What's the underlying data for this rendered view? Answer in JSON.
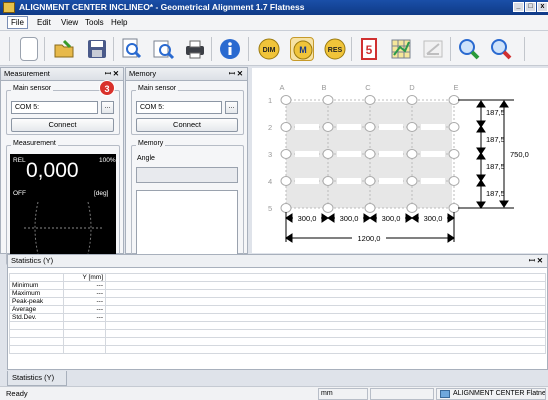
{
  "window": {
    "title": "ALIGNMENT CENTER INCLINEO* - Geometrical Alignment 1.7 Flatness",
    "min_label": "_",
    "max_label": "□",
    "close_label": "x"
  },
  "menu": {
    "file": "File",
    "edit": "Edit",
    "view": "View",
    "tools": "Tools",
    "help": "Help"
  },
  "toolbar": {
    "dim": "DIM",
    "m": "M",
    "res": "RES"
  },
  "measurement_panel": {
    "title": "Measurement",
    "pin": "ꟷ",
    "close": "✕",
    "main_sensor_label": "Main sensor",
    "port": "COM 5:",
    "browse": "...",
    "badge": "3",
    "connect": "Connect",
    "measurement_label": "Measurement",
    "rel": "REL",
    "value": "0,000",
    "percent": "100%",
    "off": "OFF",
    "unit": "[deg]"
  },
  "memory_panel": {
    "title": "Memory",
    "pin": "ꟷ",
    "close": "✕",
    "main_sensor_label": "Main sensor",
    "port": "COM 5:",
    "browse": "...",
    "connect": "Connect",
    "memory_label": "Memory",
    "angle_label": "Angle"
  },
  "diagram": {
    "columns": [
      "A",
      "B",
      "C",
      "D",
      "E"
    ],
    "rows": [
      "1",
      "2",
      "3",
      "4",
      "5"
    ],
    "row_spacing": "187,5",
    "col_spacing": "300,0",
    "total_width": "1200,0",
    "total_height": "750,0"
  },
  "statistics": {
    "title": "Statistics (Y)",
    "pin": "ꟷ",
    "close": "✕",
    "column_header": "Y [mm]",
    "rows": [
      {
        "label": "Minimum",
        "value": "---"
      },
      {
        "label": "Maximum",
        "value": "---"
      },
      {
        "label": "Peak-peak",
        "value": "---"
      },
      {
        "label": "Average",
        "value": "---"
      },
      {
        "label": "Std.Dev.",
        "value": "---"
      }
    ],
    "tab": "Statistics (Y)"
  },
  "statusbar": {
    "status": "Ready",
    "unit": "mm",
    "app": "ALIGNMENT CENTER Flatne"
  },
  "colors": {
    "accent_blue": "#1a4fa8",
    "badge_red": "#d9312b",
    "display_bg": "#000000"
  }
}
